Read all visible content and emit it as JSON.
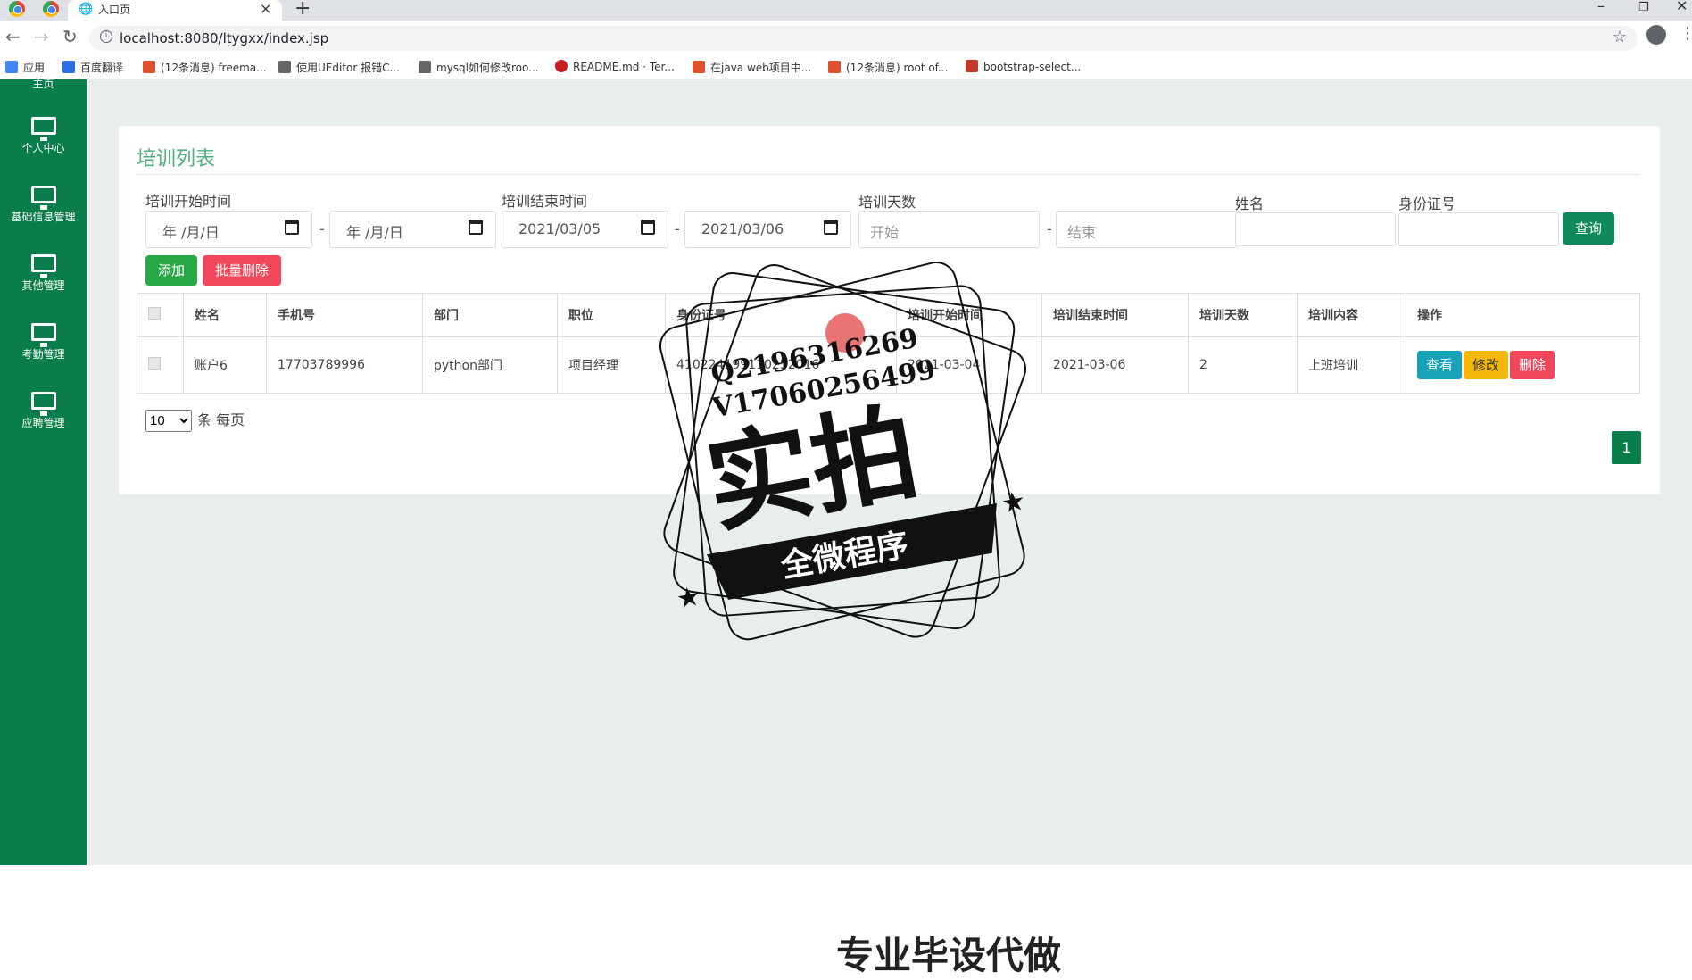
{
  "browser": {
    "tab_title": "入口页",
    "url": "localhost:8080/ltygxx/index.jsp",
    "bookmarks": [
      {
        "label": "应用",
        "color": "#4285f4"
      },
      {
        "label": "百度翻译",
        "color": "#2b6de5"
      },
      {
        "label": "(12条消息) freema...",
        "color": "#e0502d"
      },
      {
        "label": "使用UEditor 报错C...",
        "color": "#666666"
      },
      {
        "label": "mysql如何修改roo...",
        "color": "#666666"
      },
      {
        "label": "README.md · Ter...",
        "color": "#c71d23"
      },
      {
        "label": "在java web项目中...",
        "color": "#e0502d"
      },
      {
        "label": "(12条消息) root of...",
        "color": "#e0502d"
      },
      {
        "label": "bootstrap-select...",
        "color": "#c0392b"
      }
    ]
  },
  "sidebar": {
    "items": [
      {
        "label": "主页"
      },
      {
        "label": "个人中心"
      },
      {
        "label": "基础信息管理"
      },
      {
        "label": "其他管理"
      },
      {
        "label": "考勤管理"
      },
      {
        "label": "应聘管理"
      }
    ]
  },
  "card": {
    "title": "培训列表",
    "filters": {
      "start_label": "培训开始时间",
      "start_from": "年 /月/日",
      "start_to": "年 /月/日",
      "end_label": "培训结束时间",
      "end_from": "2021/03/05",
      "end_to": "2021/03/06",
      "days_label": "培训天数",
      "days_from_placeholder": "开始",
      "days_to_placeholder": "结束",
      "name_label": "姓名",
      "idcard_label": "身份证号",
      "dash": "-",
      "query_button": "查询"
    },
    "add_button": "添加",
    "batch_delete_button": "批量删除",
    "table": {
      "headers": [
        "姓名",
        "手机号",
        "部门",
        "职位",
        "身份证号",
        "培训开始时间",
        "培训结束时间",
        "培训天数",
        "培训内容",
        "操作"
      ],
      "rows": [
        {
          "name": "账户6",
          "phone": "17703789996",
          "dept": "python部门",
          "position": "项目经理",
          "idcard": "410224199110252016",
          "start": "2021-03-04",
          "end": "2021-03-06",
          "days": "2",
          "content": "上班培训",
          "view": "查看",
          "edit": "修改",
          "delete": "删除"
        }
      ]
    },
    "page_size": "10",
    "page_size_suffix": "条 每页",
    "current_page": "1"
  },
  "watermark": {
    "line1": "Q2196316269",
    "line2": "V17060256499",
    "big": "实拍",
    "banner": "全微程序"
  },
  "bottom_text": "专业毕设代做"
}
